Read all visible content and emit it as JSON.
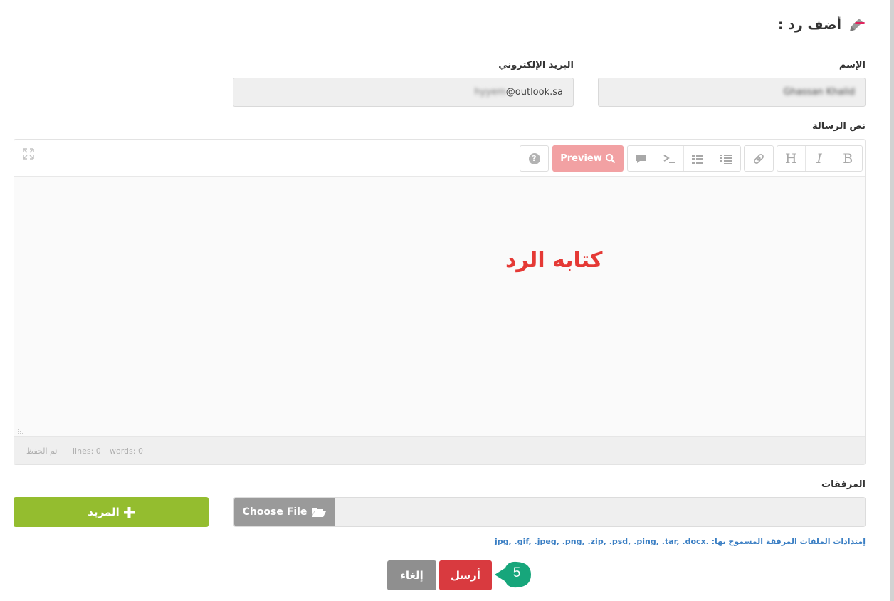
{
  "reply": {
    "title": "أضف رد :",
    "icon": "pencil-icon",
    "collapse_icon": "minus-icon",
    "accent_color": "#e0245e"
  },
  "form": {
    "name_label": "الإسم",
    "name_value": "Ghassan Khalid",
    "email_label": "البريد الإلكتروني",
    "email_value_hidden": "hyyem",
    "email_value": "@outlook.sa",
    "message_label": "نص الرسالة",
    "attachments_label": "المرفقات"
  },
  "editor": {
    "toolbar": {
      "bold": "B",
      "italic": "I",
      "heading": "H",
      "preview": "Preview",
      "help": "?"
    },
    "annotation": "كتابه الرد",
    "annotation_color": "#e53935",
    "status": {
      "saved": "تم الحفظ",
      "lines": "lines: 0",
      "words": "words: 0"
    }
  },
  "upload": {
    "choose_label": "Choose File",
    "more_label": "المزيد",
    "extensions_note": "إمتدادات الملفات المرفقة المسموح بها: .jpg, .gif, .jpeg, .png, .zip, .psd, .ping, .tar, .docx"
  },
  "actions": {
    "send": "أرسل",
    "cancel": "إلغاء",
    "step_number": "5",
    "send_color": "#d93a3f",
    "more_color": "#94bd2f",
    "step_color": "#17a67b"
  }
}
